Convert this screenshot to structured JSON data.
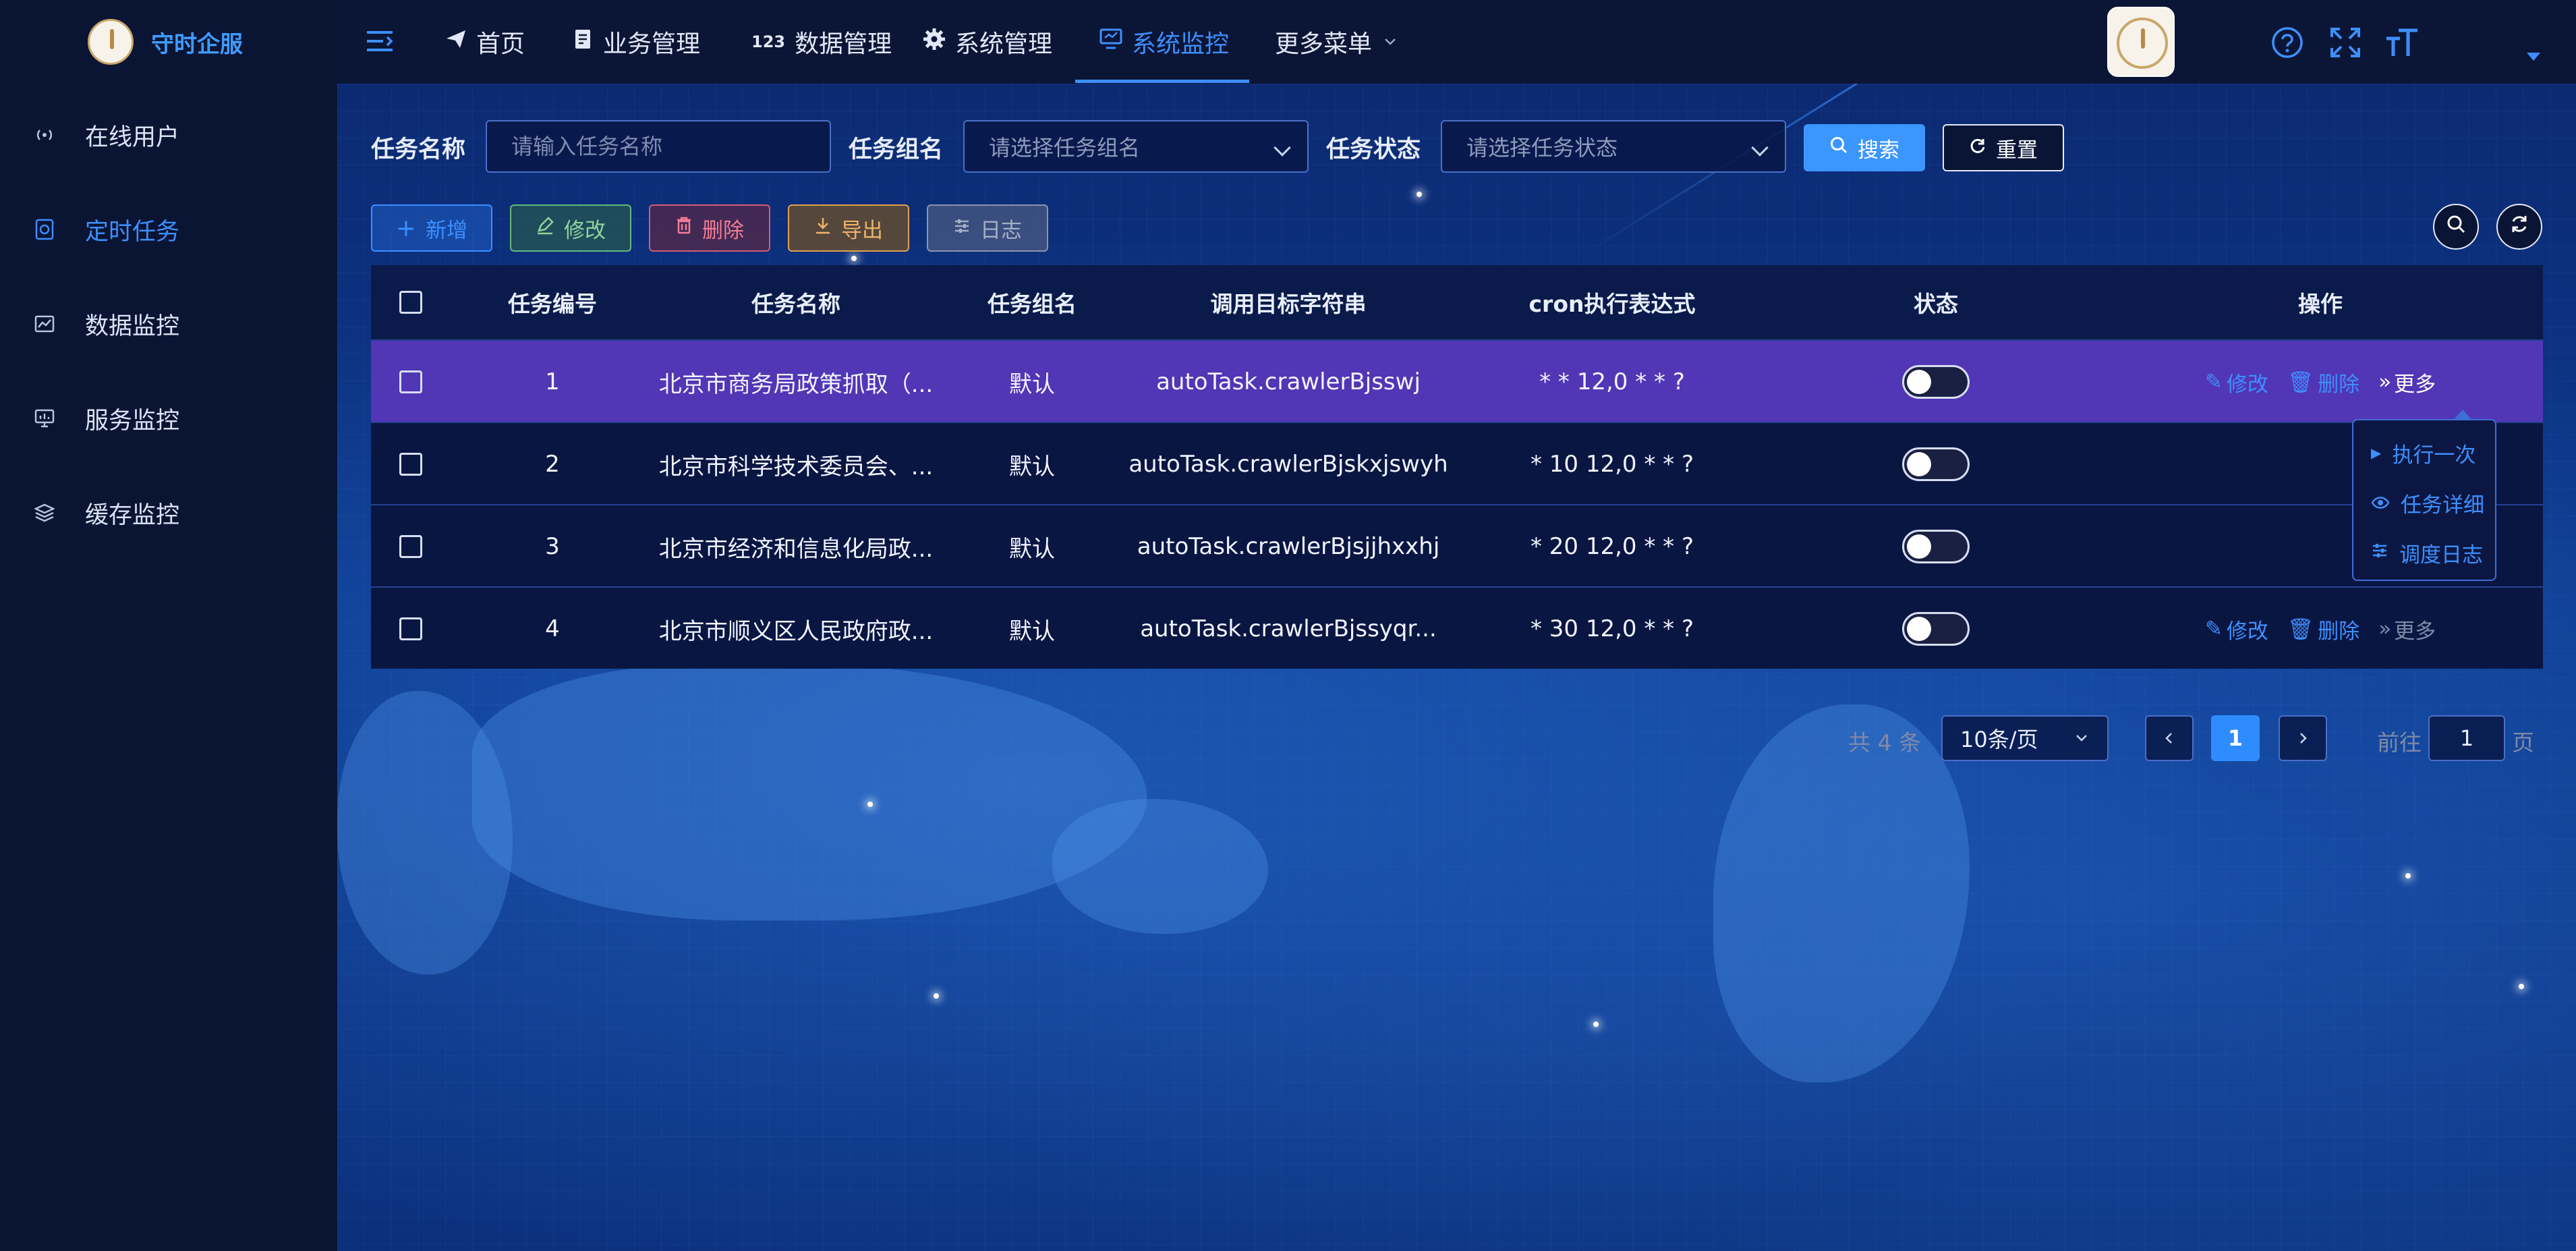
{
  "app": {
    "name": "守时企服"
  },
  "sidebar": {
    "items": [
      {
        "label": "在线用户",
        "icon": "online-users-icon",
        "active": false
      },
      {
        "label": "定时任务",
        "icon": "scheduled-task-icon",
        "active": true
      },
      {
        "label": "数据监控",
        "icon": "data-monitor-icon",
        "active": false
      },
      {
        "label": "服务监控",
        "icon": "service-monitor-icon",
        "active": false
      },
      {
        "label": "缓存监控",
        "icon": "cache-monitor-icon",
        "active": false
      }
    ]
  },
  "topnav": {
    "items": [
      {
        "label": "首页",
        "icon": "send-icon"
      },
      {
        "label": "业务管理",
        "icon": "document-icon"
      },
      {
        "label": "数据管理",
        "icon": "number-icon"
      },
      {
        "label": "系统管理",
        "icon": "gear-icon"
      },
      {
        "label": "系统监控",
        "icon": "monitor-icon",
        "active": true
      },
      {
        "label": "更多菜单",
        "icon": "chevron-down-icon"
      }
    ],
    "right_icons": [
      "help-icon",
      "fullscreen-icon",
      "font-size-icon"
    ]
  },
  "search": {
    "task_name_label": "任务名称",
    "task_name_placeholder": "请输入任务名称",
    "task_group_label": "任务组名",
    "task_group_placeholder": "请选择任务组名",
    "task_status_label": "任务状态",
    "task_status_placeholder": "请选择任务状态",
    "search_button": "搜索",
    "reset_button": "重置"
  },
  "toolbar": {
    "add": "新增",
    "edit": "修改",
    "delete": "删除",
    "export": "导出",
    "log": "日志"
  },
  "table": {
    "columns": [
      "任务编号",
      "任务名称",
      "任务组名",
      "调用目标字符串",
      "cron执行表达式",
      "状态",
      "操作"
    ],
    "rows": [
      {
        "id": "1",
        "name": "北京市商务局政策抓取（...",
        "group": "默认",
        "target": "autoTask.crawlerBjsswj",
        "cron": "* * 12,0 * * ?",
        "status": false
      },
      {
        "id": "2",
        "name": "北京市科学技术委员会、...",
        "group": "默认",
        "target": "autoTask.crawlerBjskxjswyh",
        "cron": "* 10 12,0 * * ?",
        "status": false
      },
      {
        "id": "3",
        "name": "北京市经济和信息化局政...",
        "group": "默认",
        "target": "autoTask.crawlerBjsjjhxxhj",
        "cron": "* 20 12,0 * * ?",
        "status": false
      },
      {
        "id": "4",
        "name": "北京市顺义区人民政府政...",
        "group": "默认",
        "target": "autoTask.crawlerBjssyqr...",
        "cron": "* 30 12,0 * * ?",
        "status": false
      }
    ],
    "op_edit": "修改",
    "op_delete": "删除",
    "op_more": "更多"
  },
  "more_menu": {
    "items": [
      {
        "label": "执行一次",
        "icon": "play-icon"
      },
      {
        "label": "任务详细",
        "icon": "eye-icon"
      },
      {
        "label": "调度日志",
        "icon": "log-icon"
      }
    ]
  },
  "pagination": {
    "total": "共 4 条",
    "page_size": "10条/页",
    "current_page": "1",
    "goto_label": "前往",
    "goto_value": "1",
    "page_suffix": "页"
  },
  "colors": {
    "accent": "#3d8fff",
    "selected_row": "#5136b5"
  }
}
